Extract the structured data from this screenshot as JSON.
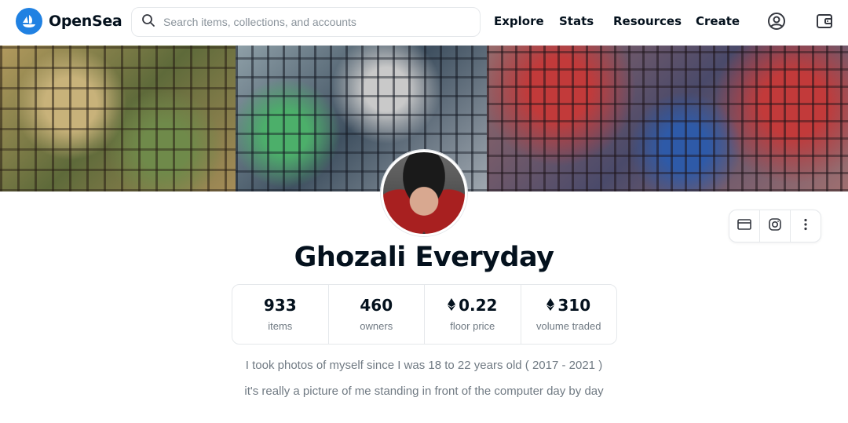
{
  "header": {
    "brand": "OpenSea",
    "search_placeholder": "Search items, collections, and accounts",
    "nav": {
      "explore": "Explore",
      "stats": "Stats",
      "resources": "Resources",
      "create": "Create"
    },
    "icons": [
      "search-icon",
      "account-icon",
      "wallet-icon"
    ]
  },
  "collection": {
    "name": "Ghozali Everyday",
    "stats": [
      {
        "value": "933",
        "label": "items",
        "eth": false
      },
      {
        "value": "460",
        "label": "owners",
        "eth": false
      },
      {
        "value": "0.22",
        "label": "floor price",
        "eth": true
      },
      {
        "value": "310",
        "label": "volume traded",
        "eth": true
      }
    ],
    "description_lines": [
      "I took photos of myself since I was 18 to 22 years old ( 2017 - 2021 )",
      "it's really a picture of me standing in front of the computer day by day"
    ],
    "actions": [
      "website-icon",
      "instagram-icon",
      "more-options-icon"
    ]
  },
  "colors": {
    "brand_blue": "#2081e2",
    "text_dark": "#04111d",
    "text_muted": "#707a83",
    "border": "#e5e8eb"
  }
}
